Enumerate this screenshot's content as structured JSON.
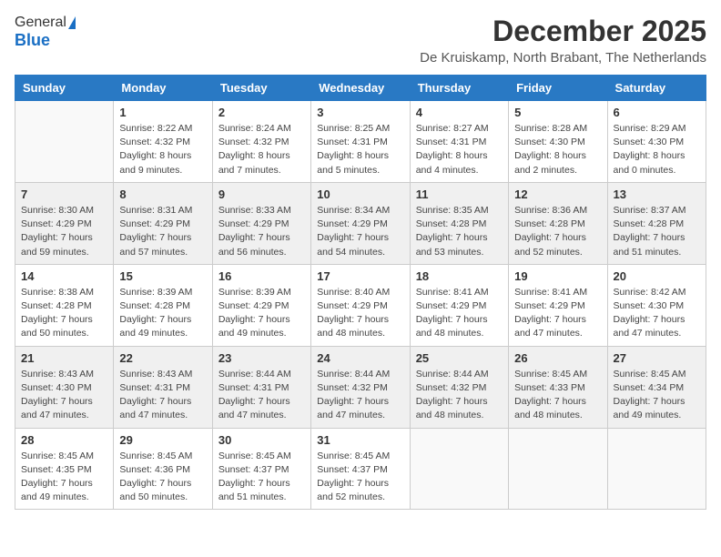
{
  "header": {
    "logo_general": "General",
    "logo_blue": "Blue",
    "month_title": "December 2025",
    "location": "De Kruiskamp, North Brabant, The Netherlands"
  },
  "days_of_week": [
    "Sunday",
    "Monday",
    "Tuesday",
    "Wednesday",
    "Thursday",
    "Friday",
    "Saturday"
  ],
  "weeks": [
    [
      {
        "day": "",
        "info": ""
      },
      {
        "day": "1",
        "info": "Sunrise: 8:22 AM\nSunset: 4:32 PM\nDaylight: 8 hours and 9 minutes."
      },
      {
        "day": "2",
        "info": "Sunrise: 8:24 AM\nSunset: 4:32 PM\nDaylight: 8 hours and 7 minutes."
      },
      {
        "day": "3",
        "info": "Sunrise: 8:25 AM\nSunset: 4:31 PM\nDaylight: 8 hours and 5 minutes."
      },
      {
        "day": "4",
        "info": "Sunrise: 8:27 AM\nSunset: 4:31 PM\nDaylight: 8 hours and 4 minutes."
      },
      {
        "day": "5",
        "info": "Sunrise: 8:28 AM\nSunset: 4:30 PM\nDaylight: 8 hours and 2 minutes."
      },
      {
        "day": "6",
        "info": "Sunrise: 8:29 AM\nSunset: 4:30 PM\nDaylight: 8 hours and 0 minutes."
      }
    ],
    [
      {
        "day": "7",
        "info": "Sunrise: 8:30 AM\nSunset: 4:29 PM\nDaylight: 7 hours and 59 minutes."
      },
      {
        "day": "8",
        "info": "Sunrise: 8:31 AM\nSunset: 4:29 PM\nDaylight: 7 hours and 57 minutes."
      },
      {
        "day": "9",
        "info": "Sunrise: 8:33 AM\nSunset: 4:29 PM\nDaylight: 7 hours and 56 minutes."
      },
      {
        "day": "10",
        "info": "Sunrise: 8:34 AM\nSunset: 4:29 PM\nDaylight: 7 hours and 54 minutes."
      },
      {
        "day": "11",
        "info": "Sunrise: 8:35 AM\nSunset: 4:28 PM\nDaylight: 7 hours and 53 minutes."
      },
      {
        "day": "12",
        "info": "Sunrise: 8:36 AM\nSunset: 4:28 PM\nDaylight: 7 hours and 52 minutes."
      },
      {
        "day": "13",
        "info": "Sunrise: 8:37 AM\nSunset: 4:28 PM\nDaylight: 7 hours and 51 minutes."
      }
    ],
    [
      {
        "day": "14",
        "info": "Sunrise: 8:38 AM\nSunset: 4:28 PM\nDaylight: 7 hours and 50 minutes."
      },
      {
        "day": "15",
        "info": "Sunrise: 8:39 AM\nSunset: 4:28 PM\nDaylight: 7 hours and 49 minutes."
      },
      {
        "day": "16",
        "info": "Sunrise: 8:39 AM\nSunset: 4:29 PM\nDaylight: 7 hours and 49 minutes."
      },
      {
        "day": "17",
        "info": "Sunrise: 8:40 AM\nSunset: 4:29 PM\nDaylight: 7 hours and 48 minutes."
      },
      {
        "day": "18",
        "info": "Sunrise: 8:41 AM\nSunset: 4:29 PM\nDaylight: 7 hours and 48 minutes."
      },
      {
        "day": "19",
        "info": "Sunrise: 8:41 AM\nSunset: 4:29 PM\nDaylight: 7 hours and 47 minutes."
      },
      {
        "day": "20",
        "info": "Sunrise: 8:42 AM\nSunset: 4:30 PM\nDaylight: 7 hours and 47 minutes."
      }
    ],
    [
      {
        "day": "21",
        "info": "Sunrise: 8:43 AM\nSunset: 4:30 PM\nDaylight: 7 hours and 47 minutes."
      },
      {
        "day": "22",
        "info": "Sunrise: 8:43 AM\nSunset: 4:31 PM\nDaylight: 7 hours and 47 minutes."
      },
      {
        "day": "23",
        "info": "Sunrise: 8:44 AM\nSunset: 4:31 PM\nDaylight: 7 hours and 47 minutes."
      },
      {
        "day": "24",
        "info": "Sunrise: 8:44 AM\nSunset: 4:32 PM\nDaylight: 7 hours and 47 minutes."
      },
      {
        "day": "25",
        "info": "Sunrise: 8:44 AM\nSunset: 4:32 PM\nDaylight: 7 hours and 48 minutes."
      },
      {
        "day": "26",
        "info": "Sunrise: 8:45 AM\nSunset: 4:33 PM\nDaylight: 7 hours and 48 minutes."
      },
      {
        "day": "27",
        "info": "Sunrise: 8:45 AM\nSunset: 4:34 PM\nDaylight: 7 hours and 49 minutes."
      }
    ],
    [
      {
        "day": "28",
        "info": "Sunrise: 8:45 AM\nSunset: 4:35 PM\nDaylight: 7 hours and 49 minutes."
      },
      {
        "day": "29",
        "info": "Sunrise: 8:45 AM\nSunset: 4:36 PM\nDaylight: 7 hours and 50 minutes."
      },
      {
        "day": "30",
        "info": "Sunrise: 8:45 AM\nSunset: 4:37 PM\nDaylight: 7 hours and 51 minutes."
      },
      {
        "day": "31",
        "info": "Sunrise: 8:45 AM\nSunset: 4:37 PM\nDaylight: 7 hours and 52 minutes."
      },
      {
        "day": "",
        "info": ""
      },
      {
        "day": "",
        "info": ""
      },
      {
        "day": "",
        "info": ""
      }
    ]
  ]
}
